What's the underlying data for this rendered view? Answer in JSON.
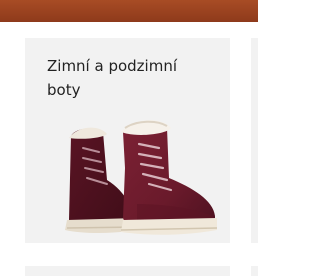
{
  "category_card": {
    "title": "Zimní a podzimní boty",
    "image_icon": "winter-boots-image"
  },
  "colors": {
    "top_band": "#9a4220",
    "card_background": "#f2f2f2",
    "boot_leather": "#6e1a2c",
    "fur_lining": "#f3eee6",
    "sole": "#ece4d6",
    "laces": "#c9a2ab"
  }
}
